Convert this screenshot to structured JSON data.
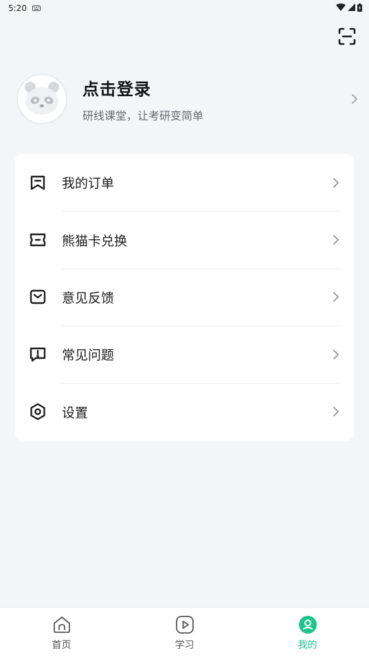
{
  "status_bar": {
    "time": "5:20"
  },
  "header": {
    "scan_icon": "scan-icon"
  },
  "profile": {
    "title": "点击登录",
    "subtitle": "研线课堂，让考研变简单",
    "avatar_icon": "panda-avatar"
  },
  "menu": {
    "items": [
      {
        "label": "我的订单",
        "icon": "bookmark-icon"
      },
      {
        "label": "熊猫卡兑换",
        "icon": "ticket-icon"
      },
      {
        "label": "意见反馈",
        "icon": "mail-icon"
      },
      {
        "label": "常见问题",
        "icon": "alert-message-icon"
      },
      {
        "label": "设置",
        "icon": "hexagon-settings-icon"
      }
    ]
  },
  "bottom_nav": {
    "items": [
      {
        "label": "首页",
        "icon": "home-icon",
        "active": false
      },
      {
        "label": "学习",
        "icon": "play-icon",
        "active": false
      },
      {
        "label": "我的",
        "icon": "user-icon",
        "active": true
      }
    ]
  },
  "colors": {
    "accent": "#1fc48a",
    "background": "#f4f5f7",
    "card": "#ffffff"
  }
}
